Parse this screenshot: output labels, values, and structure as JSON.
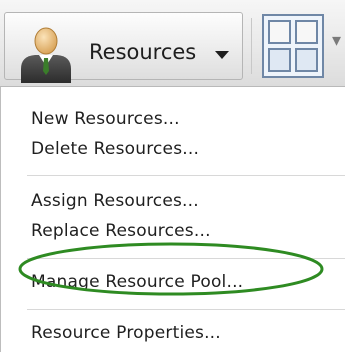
{
  "toolbar": {
    "resources_label": "Resources",
    "person_icon": "person-icon",
    "caret_icon": "caret-down-icon",
    "window_icon": "window-layout-icon",
    "more_glyph": "▾"
  },
  "menu": {
    "items": [
      {
        "label": "New Resources..."
      },
      {
        "label": "Delete Resources..."
      },
      {
        "label": "Assign Resources..."
      },
      {
        "label": "Replace Resources..."
      },
      {
        "label": "Manage Resource Pool..."
      },
      {
        "label": "Resource Properties..."
      }
    ],
    "highlight_color": "#2e8b22"
  }
}
